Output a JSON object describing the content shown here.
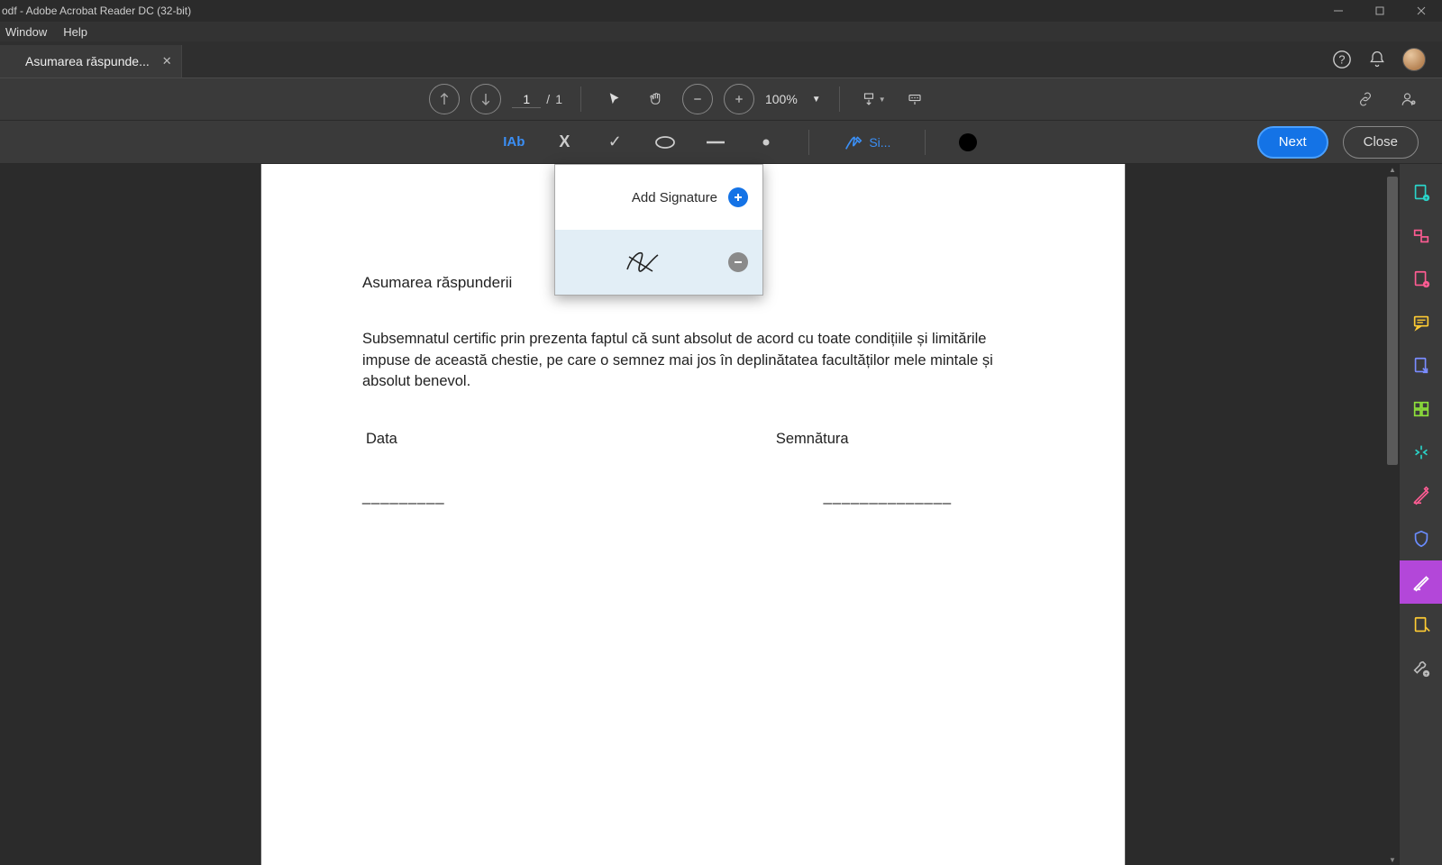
{
  "window": {
    "title": "odf - Adobe Acrobat Reader DC (32-bit)"
  },
  "menu": {
    "window": "Window",
    "help": "Help"
  },
  "tab": {
    "label": "Asumarea răspunde..."
  },
  "paging": {
    "current": "1",
    "sep": "/",
    "total": "1"
  },
  "zoom": {
    "level": "100%"
  },
  "sign": {
    "label": "Si..."
  },
  "buttons": {
    "next": "Next",
    "close": "Close"
  },
  "popup": {
    "add": "Add Signature"
  },
  "doc": {
    "title": "Asumarea răspunderii",
    "body": "Subsemnatul certific prin prezenta faptul că sunt absolut de acord cu toate condițiile și limitările impuse de această chestie, pe care o semnez mai jos în deplinătatea facultăților mele mintale și absolut benevol.",
    "date": "Data",
    "sig": "Semnătura",
    "line1": "_________",
    "line2": "______________"
  },
  "fillglyphs": {
    "ab": "IAb",
    "x": "X",
    "check": "✓"
  }
}
